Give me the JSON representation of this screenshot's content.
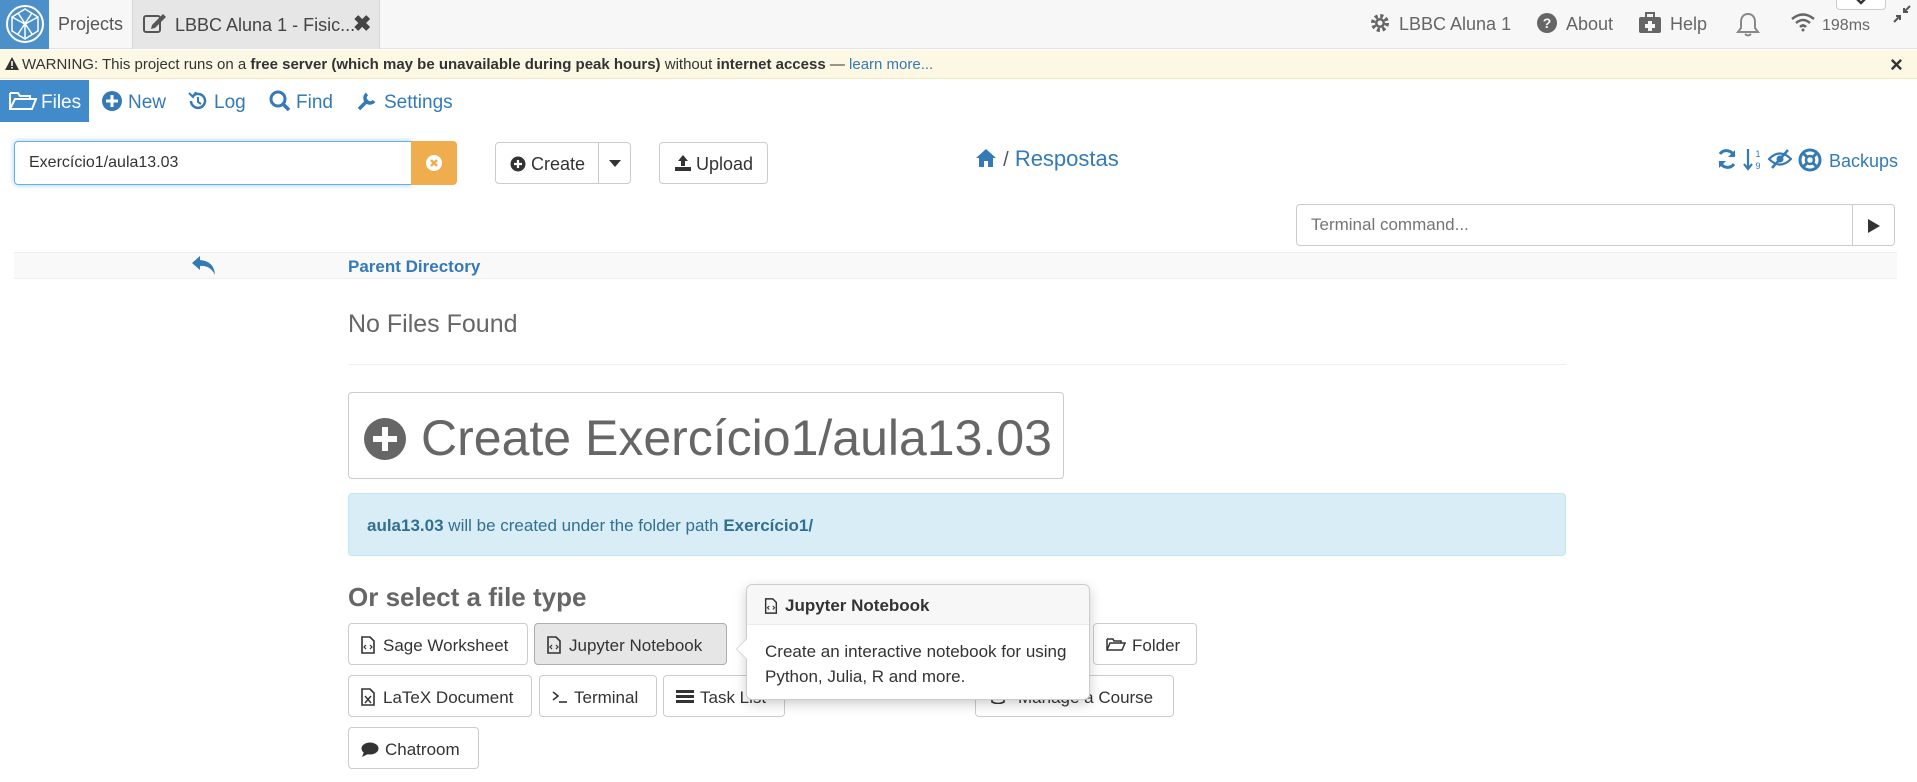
{
  "topbar": {
    "projects_label": "Projects",
    "file_tab_label": "LBBC Aluna 1 - Fisic...",
    "file_tab_close": "✖",
    "project_settings_label": "LBBC Aluna 1",
    "about_label": "About",
    "help_label": "Help",
    "ping": "198ms"
  },
  "warning": {
    "prefix": "WARNING: This project runs on a",
    "free_server": "free server (which may be unavailable during peak hours)",
    "middle": "without",
    "internet_access": "internet access",
    "dash": "—",
    "learn_more": "learn more...",
    "close": "×"
  },
  "nav": {
    "files": "Files",
    "new": "New",
    "log": "Log",
    "find": "Find",
    "settings": "Settings"
  },
  "search": {
    "value": "Exercício1/aula13.03"
  },
  "buttons": {
    "create": "Create",
    "upload": "Upload"
  },
  "breadcrumb": {
    "separator": "/",
    "current": "Respostas"
  },
  "backups_label": "Backups",
  "terminal": {
    "placeholder": "Terminal command..."
  },
  "parent_directory": "Parent Directory",
  "no_files": "No Files Found",
  "big_create": "Create Exercício1/aula13.03",
  "info": {
    "name": "aula13.03",
    "middle": "will be created under the folder path",
    "path": "Exercício1/"
  },
  "file_type_title": "Or select a file type",
  "file_types": {
    "sage": "Sage Worksheet",
    "jupyter": "Jupyter Notebook",
    "folder": "Folder",
    "latex": "LaTeX Document",
    "terminal": "Terminal",
    "tasklist": "Task List",
    "course": "Manage a Course",
    "chatroom": "Chatroom"
  },
  "popover": {
    "title": "Jupyter Notebook",
    "body": "Create an interactive notebook for using Python, Julia, R and more."
  },
  "colors": {
    "primary": "#428bca",
    "link": "#337ab7",
    "warning_bg": "#fcf8e3",
    "info_bg": "#d9edf7",
    "clear": "#f0ad4e"
  }
}
